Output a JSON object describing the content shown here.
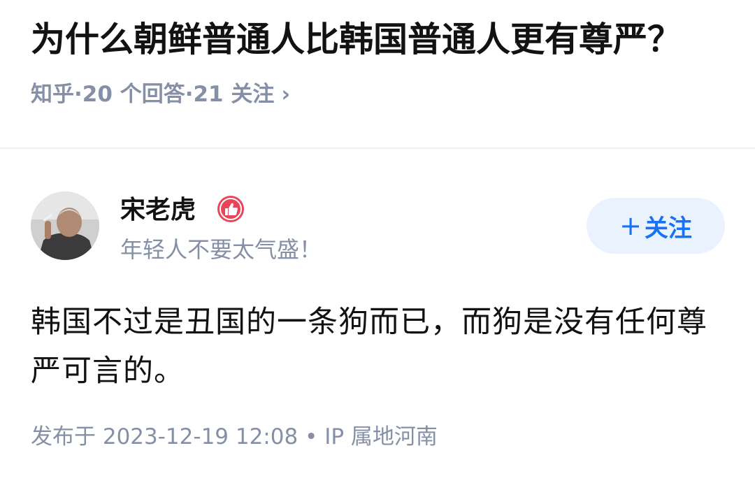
{
  "question": {
    "title": "为什么朝鲜普通人比韩国普通人更有尊严？",
    "meta": "知乎·20 个回答·21 关注",
    "meta_arrow": "›"
  },
  "author": {
    "name": "宋老虎",
    "bio": "年轻人不要太气盛！",
    "avatar_icon": "avatar-photo",
    "badge_icon": "thumbs-up-badge-icon"
  },
  "follow_button": {
    "plus": "+",
    "label": "关注"
  },
  "answer": {
    "text": "韩国不过是丑国的一条狗而已，而狗是没有任何尊严可言的。",
    "footer": "发布于 2023-12-19 12:08 • IP 属地河南"
  },
  "colors": {
    "accent": "#1772f6",
    "muted": "#8590a6",
    "text": "#121212",
    "badge": "#e8445a"
  }
}
